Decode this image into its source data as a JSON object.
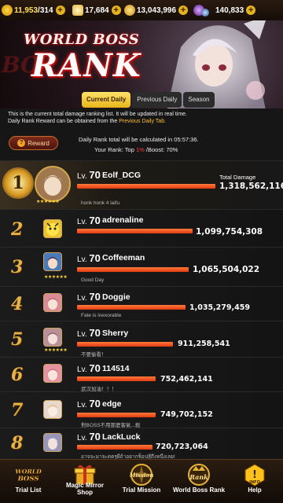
{
  "resources": {
    "stamina": "11,953",
    "stamina_max": "/314",
    "gems": "17,684",
    "gold": "13,043,996",
    "points": "140,833",
    "plus": "+"
  },
  "banner": {
    "logo_top": "WORLD BOSS",
    "logo_main": "RANK",
    "logo_ghost": "BO"
  },
  "tabs": [
    "Current Daily",
    "Previous Daily",
    "Season"
  ],
  "info": {
    "line1": "This is the current total damage ranking list. It will be updated in real time.",
    "line2_pre": "Daily Rank Reward can be obtained from the ",
    "line2_link": "Previous Daily Tab.",
    "reward_label": "Reward",
    "reward_icon": "?",
    "calc_text": "Daily Rank total will be calculated in 05:57:36.",
    "your_rank_pre": "Your Rank: Top ",
    "your_rank_val": "1%",
    "your_rank_post": " /Boost: 70%"
  },
  "list": {
    "total_label": "Total Damage",
    "lv_prefix": "Lv.",
    "stars": "★★★★★★",
    "rows": [
      {
        "rank": "1",
        "level": "70",
        "name": "Eolf_DCG",
        "damage": "1,318,562,116",
        "bio": "honk honk 4 laifu",
        "bar": 1.0
      },
      {
        "rank": "2",
        "level": "70",
        "name": "adrenaline",
        "damage": "1,099,754,308",
        "bio": "",
        "bar": 0.834
      },
      {
        "rank": "3",
        "level": "70",
        "name": "Coffeeman",
        "damage": "1,065,504,022",
        "bio": "Good Day",
        "bar": 0.808
      },
      {
        "rank": "4",
        "level": "70",
        "name": "Doggie",
        "damage": "1,035,279,459",
        "bio": "Fate is inexorable",
        "bar": 0.785
      },
      {
        "rank": "5",
        "level": "70",
        "name": "Sherry",
        "damage": "911,258,541",
        "bio": "不要偷看！",
        "bar": 0.691
      },
      {
        "rank": "6",
        "level": "70",
        "name": "114514",
        "damage": "752,462,141",
        "bio": "武汉加油！！！",
        "bar": 0.571
      },
      {
        "rank": "7",
        "level": "70",
        "name": "edge",
        "damage": "749,702,152",
        "bio": "對BOSS不用那麼客氣...殺",
        "bar": 0.569
      },
      {
        "rank": "8",
        "level": "70",
        "name": "LackLuck",
        "damage": "720,723,064",
        "bio": "อาจจะมาจะดตรูผีถ้าอยากช็อปสู้ถึงหนึ่งเลย!",
        "bar": 0.547
      }
    ]
  },
  "nav": [
    {
      "label": "Trial List",
      "icon": "world-boss-icon",
      "icon_text": "WORLD BOSS"
    },
    {
      "label": "Magic Mirror\nShop",
      "icon": "gift-icon"
    },
    {
      "label": "Trial Mission",
      "icon": "mission-icon",
      "icon_text": "Mission"
    },
    {
      "label": "World Boss Rank",
      "icon": "rank-icon",
      "icon_text": "Rank"
    },
    {
      "label": "Help",
      "icon": "info-icon",
      "icon_text": "!"
    }
  ]
}
